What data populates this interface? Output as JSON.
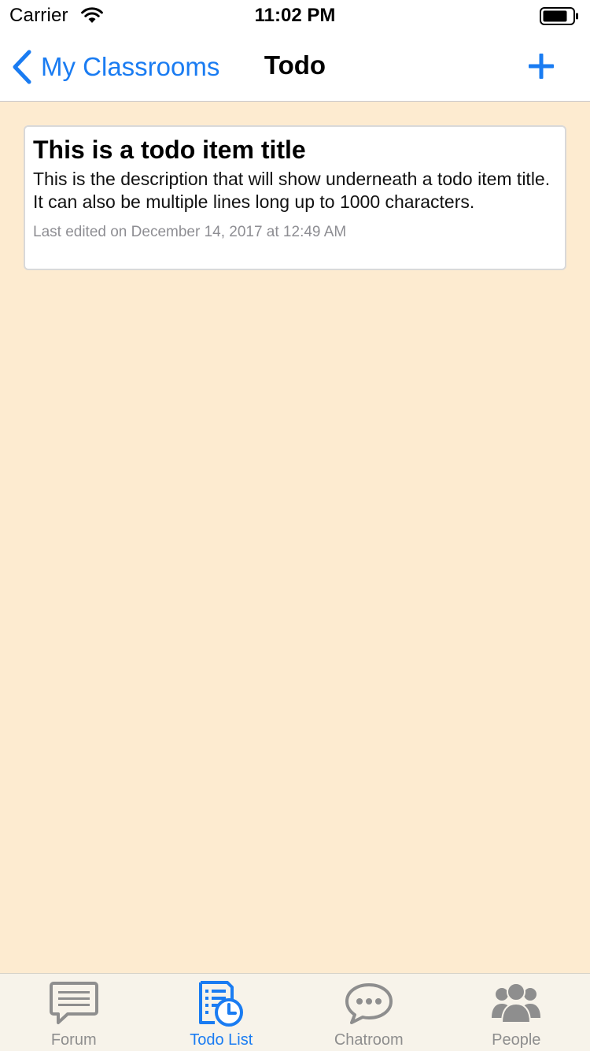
{
  "status_bar": {
    "carrier": "Carrier",
    "time": "11:02 PM"
  },
  "nav": {
    "back_label": "My Classrooms",
    "title": "Todo",
    "add_icon": "plus-icon"
  },
  "todo_items": [
    {
      "title": "This is a todo item title",
      "description": "This is the description that will show underneath a todo item title. It can also be multiple lines long up to 1000 characters.",
      "last_edited": "Last edited on December 14, 2017 at 12:49 AM"
    }
  ],
  "tabs": [
    {
      "label": "Forum",
      "icon": "forum-icon",
      "active": false
    },
    {
      "label": "Todo List",
      "icon": "todo-list-icon",
      "active": true
    },
    {
      "label": "Chatroom",
      "icon": "chatroom-icon",
      "active": false
    },
    {
      "label": "People",
      "icon": "people-icon",
      "active": false
    }
  ],
  "colors": {
    "accent": "#1a7cf2",
    "content_background": "#fdebd0",
    "tab_bar_background": "#f7f3ea",
    "inactive_tab": "#8e8e8e"
  }
}
